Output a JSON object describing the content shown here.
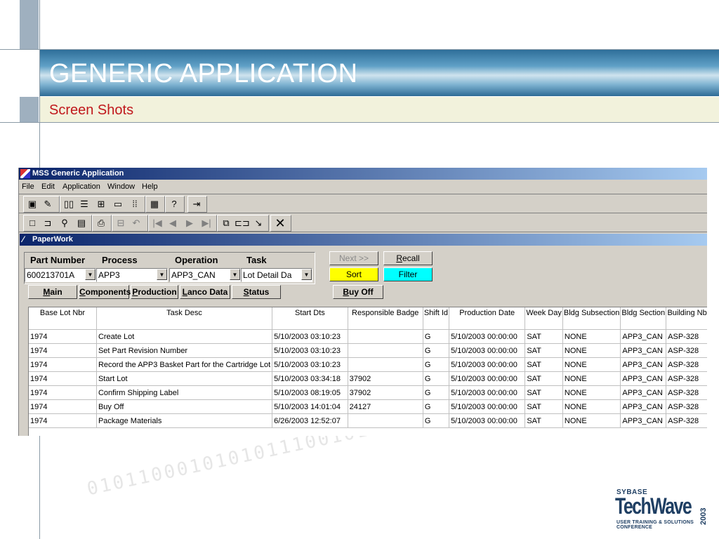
{
  "slide": {
    "title": "GENERIC APPLICATION",
    "subtitle": "Screen Shots"
  },
  "window": {
    "title": "MSS Generic Application",
    "menu": [
      "File",
      "Edit",
      "Application",
      "Window",
      "Help"
    ]
  },
  "toolbar1": {
    "icons": [
      "properties-icon",
      "edit-icon",
      "columns-icon",
      "rows-icon",
      "tree-icon",
      "window-icon",
      "grid-icon",
      "table-icon",
      "help-icon",
      "exit-icon"
    ]
  },
  "toolbar2": {
    "icons": [
      "new-icon",
      "open-icon",
      "find-icon",
      "save-icon",
      "print-icon",
      "import-icon",
      "undo-icon",
      "first-icon",
      "prev-icon",
      "next-icon",
      "last-icon",
      "copy-icon",
      "link-icon",
      "select-icon",
      "close-icon"
    ]
  },
  "paperwork": {
    "title": "PaperWork",
    "fields": {
      "part_number": {
        "label": "Part Number",
        "value": "600213701A"
      },
      "process": {
        "label": "Process",
        "value": "APP3"
      },
      "operation": {
        "label": "Operation",
        "value": "APP3_CAN"
      },
      "task": {
        "label": "Task",
        "value": "Lot Detail Da"
      }
    },
    "buttons": {
      "next": "Next >>",
      "recall": "Recall",
      "sort": "Sort",
      "filter": "Filter",
      "main": "Main",
      "components": "Components",
      "production": "Production",
      "lanco_data": "Lanco Data",
      "status": "Status",
      "buy_off": "Buy Off"
    },
    "colors": {
      "sort_bg": "#ffff00",
      "filter_bg": "#00ffff"
    },
    "table": {
      "columns": [
        "Base Lot Nbr",
        "Task Desc",
        "Start Dts",
        "Responsible Badge",
        "Shift Id",
        "Production Date",
        "Week Day",
        "Bldg Subsection",
        "Bldg Section",
        "Building Nb"
      ],
      "rows": [
        [
          "1974",
          "Create Lot",
          "5/10/2003 03:10:23",
          "",
          "G",
          "5/10/2003 00:00:00",
          "SAT",
          "NONE",
          "APP3_CAN",
          "ASP-328"
        ],
        [
          "1974",
          "Set Part Revision Number",
          "5/10/2003 03:10:23",
          "",
          "G",
          "5/10/2003 00:00:00",
          "SAT",
          "NONE",
          "APP3_CAN",
          "ASP-328"
        ],
        [
          "1974",
          "Record the APP3 Basket Part for the Cartridge Lot",
          "5/10/2003 03:10:23",
          "",
          "G",
          "5/10/2003 00:00:00",
          "SAT",
          "NONE",
          "APP3_CAN",
          "ASP-328"
        ],
        [
          "1974",
          "Start Lot",
          "5/10/2003 03:34:18",
          "37902",
          "G",
          "5/10/2003 00:00:00",
          "SAT",
          "NONE",
          "APP3_CAN",
          "ASP-328"
        ],
        [
          "1974",
          "Confirm Shipping Label",
          "5/10/2003 08:19:05",
          "37902",
          "G",
          "5/10/2003 00:00:00",
          "SAT",
          "NONE",
          "APP3_CAN",
          "ASP-328"
        ],
        [
          "1974",
          "Buy Off",
          "5/10/2003 14:01:04",
          "24127",
          "G",
          "5/10/2003 00:00:00",
          "SAT",
          "NONE",
          "APP3_CAN",
          "ASP-328"
        ],
        [
          "1974",
          "Package Materials",
          "6/26/2003 12:52:07",
          "",
          "G",
          "5/10/2003 00:00:00",
          "SAT",
          "NONE",
          "APP3_CAN",
          "ASP-328"
        ]
      ]
    }
  },
  "logo": {
    "brand": "SYBASE",
    "name": "TechWave",
    "year": "2003",
    "tagline": "USER TRAINING & SOLUTIONS CONFERENCE"
  }
}
